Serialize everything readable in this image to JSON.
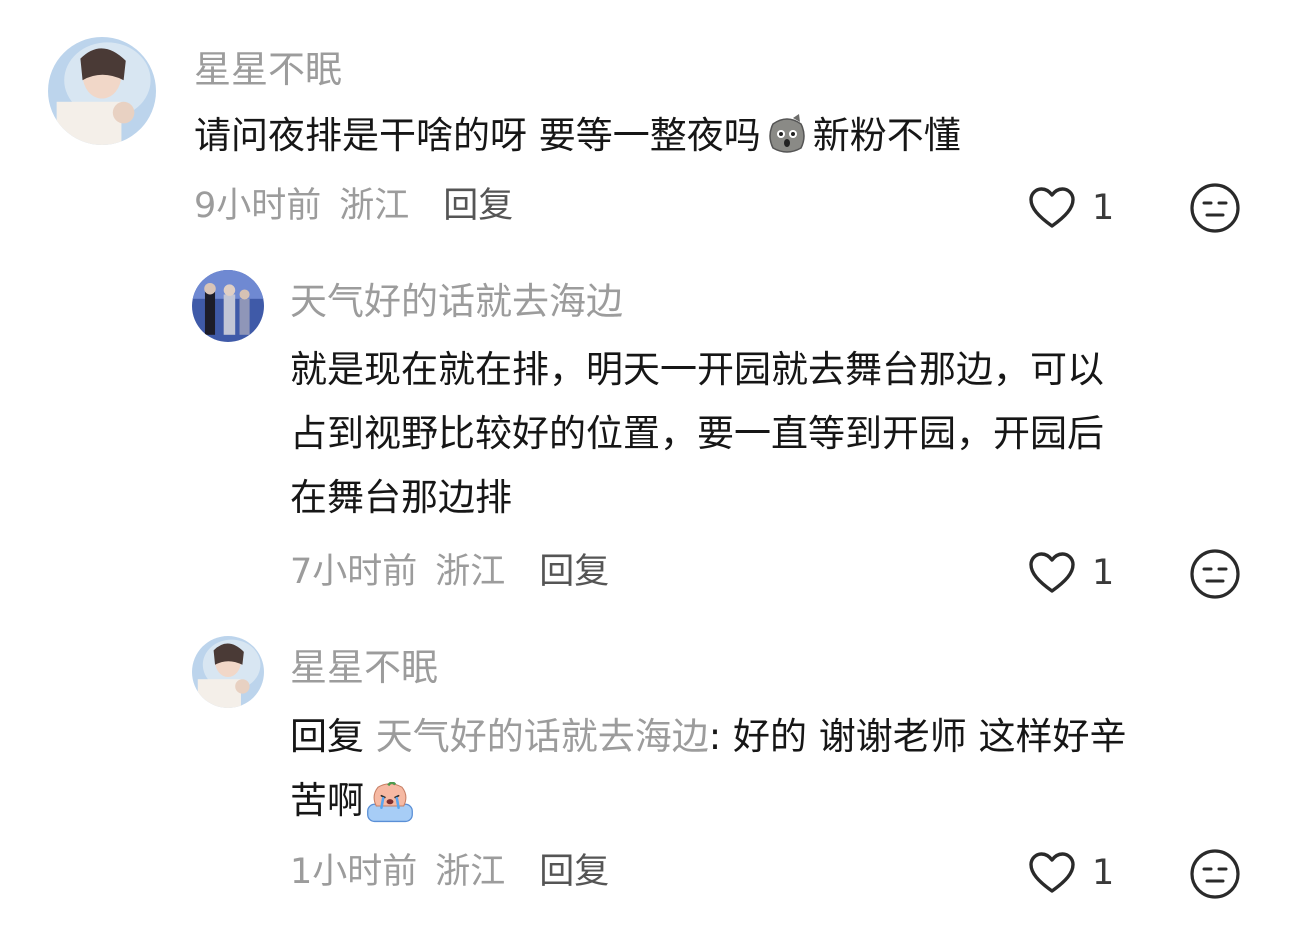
{
  "comments": [
    {
      "username": "星星不眠",
      "text_before": "请问夜排是干啥的呀 要等一整夜吗",
      "emoji": "potato-face-emoji",
      "text_after": "新粉不懂",
      "time": "9小时前",
      "location": "浙江",
      "reply_label": "回复",
      "likes": "1"
    },
    {
      "username": "天气好的话就去海边",
      "line1": "就是现在就在排，明天一开园就去舞台那边，可以",
      "line2": "占到视野比较好的位置，要一直等到开园，开园后",
      "line3": "在舞台那边排",
      "time": "7小时前",
      "location": "浙江",
      "reply_label": "回复",
      "likes": "1"
    },
    {
      "username": "星星不眠",
      "reply_prefix": "回复",
      "mention": "天气好的话就去海边",
      "text_line1": ": 好的 谢谢老师 这样好辛",
      "text_line2": "苦啊",
      "emoji": "crying-peach-emoji",
      "time": "1小时前",
      "location": "浙江",
      "reply_label": "回复",
      "likes": "1"
    }
  ]
}
